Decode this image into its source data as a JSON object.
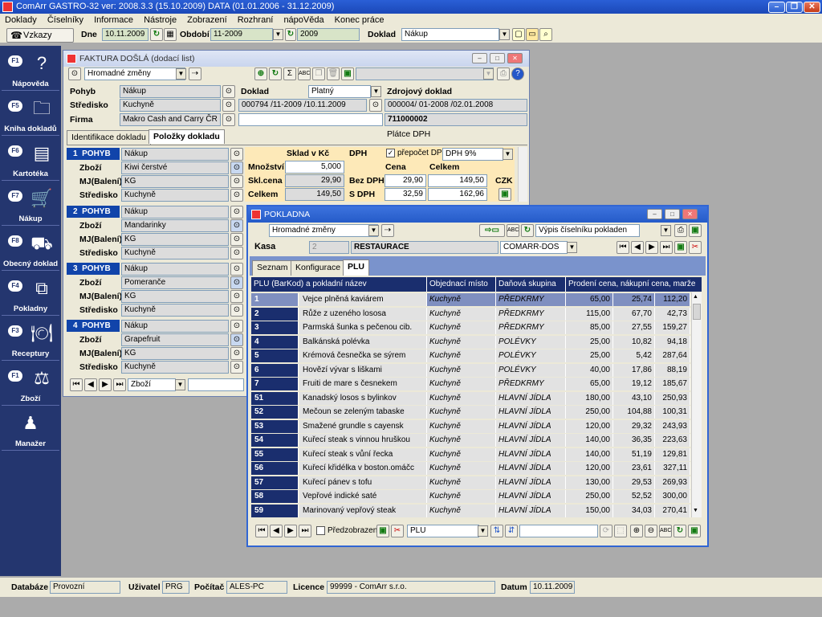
{
  "app": {
    "title": "ComArr  GASTRO-32   ver: 2008.3.3 (15.10.2009)   DATA (01.01.2006 - 31.12.2009)"
  },
  "menu": [
    "Doklady",
    "Číselníky",
    "Informace",
    "Nástroje",
    "Zobrazení",
    "Rozhraní",
    "nápoVěda",
    "Konec práce"
  ],
  "toolbar": {
    "vzkazy": "Vzkazy",
    "dne_label": "Dne",
    "dne_value": "10.11.2009",
    "obdobi_label": "Období",
    "obdobi_value": "11-2009",
    "year_value": "2009",
    "doklad_label": "Doklad",
    "doklad_value": "Nákup"
  },
  "sidebar": [
    {
      "key": "F1",
      "label": "Nápověda",
      "icon": "help-icon",
      "glyph": "?"
    },
    {
      "key": "F5",
      "label": "Kniha dokladů",
      "icon": "folder-icon",
      "glyph": "🗀"
    },
    {
      "key": "F6",
      "label": "Kartotéka",
      "icon": "card-file-icon",
      "glyph": "▤"
    },
    {
      "key": "F7",
      "label": "Nákup",
      "icon": "shopping-cart-icon",
      "glyph": "🛒"
    },
    {
      "key": "F8",
      "label": "Obecný doklad",
      "icon": "forklift-icon",
      "glyph": "⛟"
    },
    {
      "key": "F4",
      "label": "Pokladny",
      "icon": "network-icon",
      "glyph": "⧉"
    },
    {
      "key": "F3",
      "label": "Receptury",
      "icon": "cutlery-icon",
      "glyph": "🍽"
    },
    {
      "key": "F1",
      "label": "Zboží",
      "icon": "scales-icon",
      "glyph": "⚖"
    },
    {
      "key": "",
      "label": "Manažer",
      "icon": "manager-icon",
      "glyph": "♟"
    }
  ],
  "faktura": {
    "title": "FAKTURA DOŠLÁ (dodací list)",
    "filter_value": "Hromadné změny",
    "pohyb_label": "Pohyb",
    "pohyb_value": "Nákup",
    "stredisko_label": "Středisko",
    "stredisko_value": "Kuchyně",
    "firma_label": "Firma",
    "firma_value": "Makro Cash and Carry ČR s. r.",
    "doklad_label": "Doklad",
    "doklad_status": "Platný",
    "doklad_number": "000794 /11-2009 /10.11.2009",
    "zdroj_label": "Zdrojový doklad",
    "zdroj_value": "000004/ 01-2008 /02.01.2008",
    "ico_value": "711000002",
    "platce_dph": "Plátce DPH",
    "tabs": [
      "Identifikace dokladu",
      "Položky dokladu"
    ],
    "row_labels": {
      "pohyb": "POHYB",
      "zbozi": "Zboží",
      "mj": "MJ(Balení)",
      "stredisko": "Středisko"
    },
    "items": [
      {
        "num": "1",
        "pohyb": "Nákup",
        "zbozi": "Kiwi čerstvé",
        "mj": "KG",
        "stredisko": "Kuchyně"
      },
      {
        "num": "2",
        "pohyb": "Nákup",
        "zbozi": "Mandarinky",
        "mj": "KG",
        "stredisko": "Kuchyně"
      },
      {
        "num": "3",
        "pohyb": "Nákup",
        "zbozi": "Pomeranče",
        "mj": "KG",
        "stredisko": "Kuchyně"
      },
      {
        "num": "4",
        "pohyb": "Nákup",
        "zbozi": "Grapefruit",
        "mj": "KG",
        "stredisko": "Kuchyně"
      }
    ],
    "detail": {
      "sklad_label": "Sklad v Kč",
      "dph_label": "DPH",
      "prepocet_label": "přepočet DPH",
      "dph_rate": "DPH 9%",
      "mnozstvi_label": "Množství",
      "mnozstvi_value": "5,000",
      "sklcena_label": "Skl.cena",
      "sklcena_value": "29,90",
      "celkem_label": "Celkem",
      "celkem_value": "149,50",
      "cena_label": "Cena",
      "celkem2_label": "Celkem",
      "bezdph_label": "Bez DPH",
      "bezdph_cena": "29,90",
      "bezdph_celkem": "149,50",
      "sdph_label": "S DPH",
      "sdph_cena": "32,59",
      "sdph_celkem": "162,96",
      "currency": "CZK"
    },
    "bottom_filter": "Zboží"
  },
  "pokladna": {
    "title": "POKLADNA",
    "filter_value": "Hromadné změny",
    "vypis_value": "Výpis číselníku pokladen",
    "kasa_label": "Kasa",
    "kasa_num": "2",
    "kasa_name": "RESTAURACE",
    "kasa_device": "COMARR-DOS",
    "tabs": [
      "Seznam",
      "Konfigurace",
      "PLU"
    ],
    "columns": [
      "PLU (BarKod) a pokladní název",
      "Objednací místo",
      "Daňová skupina",
      "Prodení cena, nákupní cena, marže"
    ],
    "rows": [
      {
        "id": "1",
        "name": "Vejce plněná kaviárem",
        "place": "Kuchyně",
        "group": "PŘEDKRMY",
        "p1": "65,00",
        "p2": "25,74",
        "p3": "112,20"
      },
      {
        "id": "2",
        "name": "Růže z uzeného lososa",
        "place": "Kuchyně",
        "group": "PŘEDKRMY",
        "p1": "115,00",
        "p2": "67,70",
        "p3": "42,73"
      },
      {
        "id": "3",
        "name": "Parmská šunka s pečenou cib.",
        "place": "Kuchyně",
        "group": "PŘEDKRMY",
        "p1": "85,00",
        "p2": "27,55",
        "p3": "159,27"
      },
      {
        "id": "4",
        "name": "Balkánská polévka",
        "place": "Kuchyně",
        "group": "POLÉVKY",
        "p1": "25,00",
        "p2": "10,82",
        "p3": "94,18"
      },
      {
        "id": "5",
        "name": "Krémová česnečka se sýrem",
        "place": "Kuchyně",
        "group": "POLÉVKY",
        "p1": "25,00",
        "p2": "5,42",
        "p3": "287,64"
      },
      {
        "id": "6",
        "name": "Hovězí vývar s liškami",
        "place": "Kuchyně",
        "group": "POLÉVKY",
        "p1": "40,00",
        "p2": "17,86",
        "p3": "88,19"
      },
      {
        "id": "7",
        "name": "Fruiti de mare s česnekem",
        "place": "Kuchyně",
        "group": "PŘEDKRMY",
        "p1": "65,00",
        "p2": "19,12",
        "p3": "185,67"
      },
      {
        "id": "51",
        "name": "Kanadský losos s bylinkov",
        "place": "Kuchyně",
        "group": "HLAVNÍ JÍDLA",
        "p1": "180,00",
        "p2": "43,10",
        "p3": "250,93"
      },
      {
        "id": "52",
        "name": "Mečoun se zeleným tabaske",
        "place": "Kuchyně",
        "group": "HLAVNÍ JÍDLA",
        "p1": "250,00",
        "p2": "104,88",
        "p3": "100,31"
      },
      {
        "id": "53",
        "name": "Smažené grundle s cayensk",
        "place": "Kuchyně",
        "group": "HLAVNÍ JÍDLA",
        "p1": "120,00",
        "p2": "29,32",
        "p3": "243,93"
      },
      {
        "id": "54",
        "name": "Kuřecí steak s vinnou hruškou",
        "place": "Kuchyně",
        "group": "HLAVNÍ JÍDLA",
        "p1": "140,00",
        "p2": "36,35",
        "p3": "223,63"
      },
      {
        "id": "55",
        "name": "Kuřecí steak s vůní řecka",
        "place": "Kuchyně",
        "group": "HLAVNÍ JÍDLA",
        "p1": "140,00",
        "p2": "51,19",
        "p3": "129,81"
      },
      {
        "id": "56",
        "name": "Kuřecí křidélka v boston.omáčc",
        "place": "Kuchyně",
        "group": "HLAVNÍ JÍDLA",
        "p1": "120,00",
        "p2": "23,61",
        "p3": "327,11"
      },
      {
        "id": "57",
        "name": "Kuřecí pánev s tofu",
        "place": "Kuchyně",
        "group": "HLAVNÍ JÍDLA",
        "p1": "130,00",
        "p2": "29,53",
        "p3": "269,93"
      },
      {
        "id": "58",
        "name": "Vepřové indické saté",
        "place": "Kuchyně",
        "group": "HLAVNÍ JÍDLA",
        "p1": "250,00",
        "p2": "52,52",
        "p3": "300,00"
      },
      {
        "id": "59",
        "name": "Marinovaný vepřový steak",
        "place": "Kuchyně",
        "group": "HLAVNÍ JÍDLA",
        "p1": "150,00",
        "p2": "34,03",
        "p3": "270,41"
      }
    ],
    "predzobrazeni": "Předzobrazení",
    "bottom_filter": "PLU"
  },
  "status": {
    "databaze_label": "Databáze",
    "databaze_value": "Provozní",
    "uzivatel_label": "Uživatel",
    "uzivatel_value": "PRG",
    "pocitac_label": "Počítač",
    "pocitac_value": "ALES-PC",
    "licence_label": "Licence",
    "licence_value": "99999 - ComArr s.r.o.",
    "datum_label": "Datum",
    "datum_value": "10.11.2009"
  },
  "colors": {
    "sidebar": "#24366f",
    "grid_id": "#1a2e6e",
    "active_title": "#255bc8",
    "selected_row": "#7f8fc0"
  }
}
